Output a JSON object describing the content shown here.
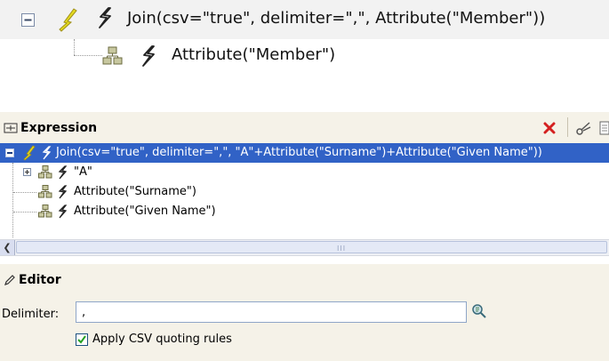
{
  "top_tree": {
    "root_label": "Join(csv=\"true\", delimiter=\",\", Attribute(\"Member\"))",
    "child_label": "Attribute(\"Member\")"
  },
  "expression_panel": {
    "title": "Expression",
    "rows": {
      "root": "Join(csv=\"true\", delimiter=\",\", \"A\"+Attribute(\"Surname\")+Attribute(\"Given Name\"))",
      "a": "\"A\"",
      "surname": "Attribute(\"Surname\")",
      "given": "Attribute(\"Given Name\")"
    },
    "selected_row_color": "#3162c6",
    "scroll_grip": "III"
  },
  "editor": {
    "title": "Editor",
    "delimiter_label": "Delimiter:",
    "delimiter_value": ",",
    "csv_label": "Apply CSV quoting rules",
    "csv_checked": true
  },
  "colors": {
    "panel_bg": "#f5f2e8",
    "accent": "#3162c6",
    "delete": "#d42020"
  }
}
